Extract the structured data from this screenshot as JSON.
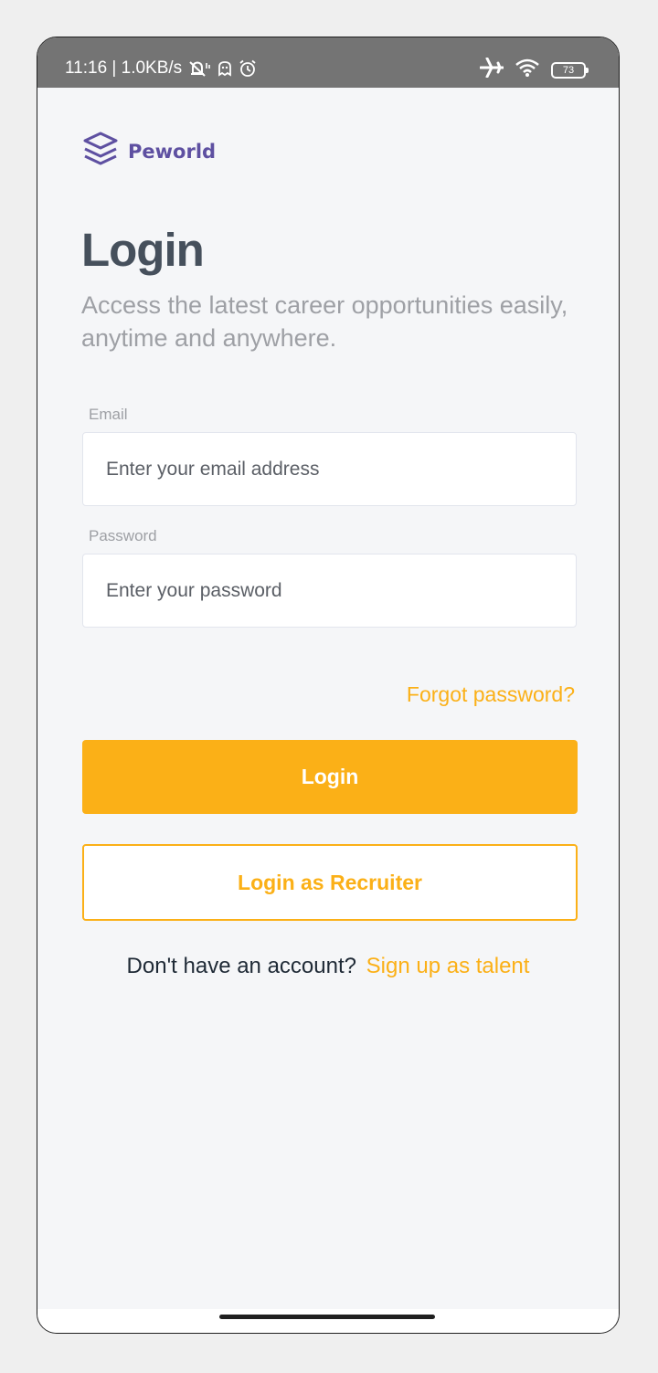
{
  "status_bar": {
    "time_and_speed": "11:16 | 1.0KB/s",
    "battery_level": "73"
  },
  "brand": {
    "name": "Peworld",
    "color": "#5e50a1"
  },
  "login": {
    "title": "Login",
    "subtitle": "Access the latest career opportunities easily, anytime and anywhere.",
    "email": {
      "label": "Email",
      "placeholder": "Enter your email address",
      "value": ""
    },
    "password": {
      "label": "Password",
      "placeholder": "Enter your password",
      "value": ""
    },
    "forgot_password": "Forgot password?",
    "login_button": "Login",
    "recruiter_button": "Login as Recruiter",
    "signup_prompt": "Don't have an account?",
    "signup_link": "Sign up as talent"
  },
  "colors": {
    "accent": "#fbb017",
    "heading": "#46505c",
    "muted": "#9ea0a5",
    "background": "#f5f6f8"
  },
  "icons": {
    "status": [
      "silent-icon",
      "data-sync-icon",
      "ghost-icon",
      "alarm-icon",
      "airplane-mode-icon",
      "wifi-icon",
      "battery-icon"
    ],
    "brand": "layers-logo-icon"
  }
}
